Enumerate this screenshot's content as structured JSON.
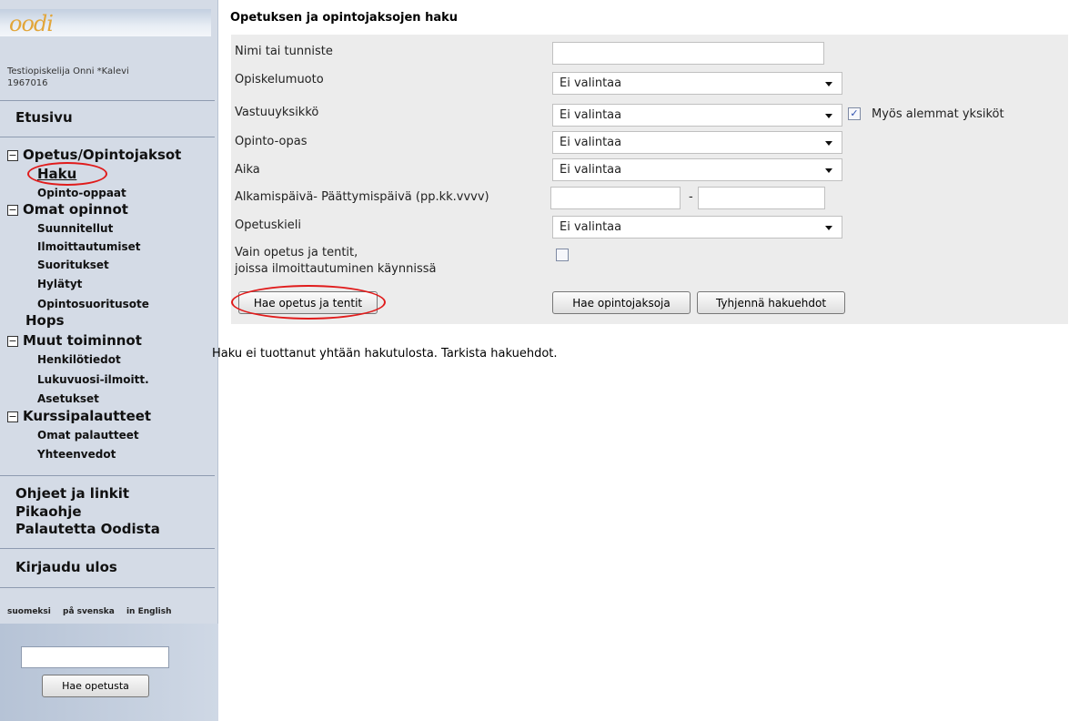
{
  "sidebar": {
    "logo_text": "oodi",
    "user_name": "Testiopiskelija Onni *Kalevi",
    "user_id": "1967016",
    "home": "Etusivu",
    "section_opetus": {
      "label": "Opetus/Opintojaksot",
      "toggle": "−",
      "items": [
        "Haku",
        "Opinto-oppaat"
      ]
    },
    "section_omat": {
      "label": "Omat opinnot",
      "toggle": "−",
      "items": [
        "Suunnitellut",
        "Ilmoittautumiset",
        "Suoritukset",
        "Hylätyt",
        "Opintosuoritusote"
      ]
    },
    "hops": "Hops",
    "section_muut": {
      "label": "Muut toiminnot",
      "toggle": "−",
      "items": [
        "Henkilötiedot",
        "Lukuvuosi-ilmoitt.",
        "Asetukset"
      ]
    },
    "section_kurssi": {
      "label": "Kurssipalautteet",
      "toggle": "−",
      "items": [
        "Omat palautteet",
        "Yhteenvedot"
      ]
    },
    "links": [
      "Ohjeet ja linkit",
      "Pikaohje",
      "Palautetta Oodista"
    ],
    "logout": "Kirjaudu ulos",
    "languages": [
      "suomeksi",
      "på svenska",
      "in English"
    ],
    "search_placeholder": "",
    "search_button": "Hae opetusta"
  },
  "main": {
    "title": "Opetuksen ja opintojaksojen haku",
    "fields": {
      "name": {
        "label": "Nimi tai tunniste",
        "value": ""
      },
      "study_mode": {
        "label": "Opiskelumuoto",
        "value": "Ei valintaa"
      },
      "unit": {
        "label": "Vastuuyksikkö",
        "value": "Ei valintaa",
        "sub_checkbox_label": "Myös alemmat yksiköt",
        "sub_checkbox_checked": true
      },
      "guide": {
        "label": "Opinto-opas",
        "value": "Ei valintaa"
      },
      "time": {
        "label": "Aika",
        "value": "Ei valintaa"
      },
      "dates": {
        "label": "Alkamispäivä- Päättymispäivä (pp.kk.vvvv)",
        "separator": "-",
        "start": "",
        "end": ""
      },
      "language": {
        "label": "Opetuskieli",
        "value": "Ei valintaa"
      },
      "only_open": {
        "label_line1": "Vain opetus ja tentit,",
        "label_line2": "joissa ilmoittautuminen käynnissä",
        "checked": false
      }
    },
    "buttons": {
      "search_teaching": "Hae opetus ja tentit",
      "search_courses": "Hae opintojaksoja",
      "clear": "Tyhjennä hakuehdot"
    },
    "result_message": "Haku ei tuottanut yhtään hakutulosta. Tarkista hakuehdot."
  },
  "colors": {
    "sidebar_bg": "#d4dbe6",
    "form_bg": "#ececec",
    "annotation_ring": "#e01b1b",
    "logo": "#e2a63a"
  }
}
